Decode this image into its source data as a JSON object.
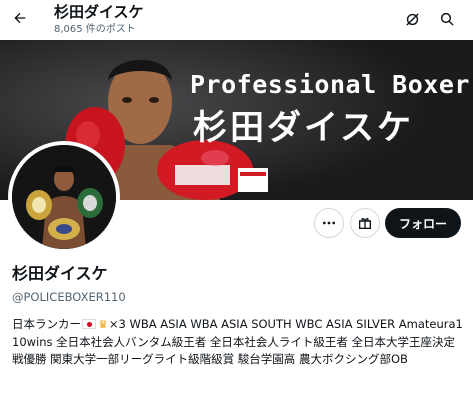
{
  "header": {
    "title": "杉田ダイスケ",
    "post_count": "8,065 件のポスト"
  },
  "banner": {
    "line1": "Professional Boxer",
    "line2": "杉田ダイスケ"
  },
  "actions": {
    "follow_label": "フォロー"
  },
  "profile": {
    "name": "杉田ダイスケ",
    "handle": "@POLICEBOXER110",
    "bio_prefix": "日本ランカー",
    "bio_main": "×3 WBA ASIA WBA ASIA SOUTH WBC ASIA SILVER Amateura110wins 全日本社会人バンタム級王者 全日本社会人ライト級王者 全日本大学王座決定戦優勝 関東大学一部リーグライト級階級賞 駿台学園高 農大ボクシング部OB"
  },
  "icons": {
    "back": "arrow-left-icon",
    "no_notify": "bell-off-icon",
    "search": "search-icon",
    "more": "more-icon",
    "gift": "gift-icon",
    "flag": "japan-flag-icon",
    "crown": "crown-icon"
  },
  "colors": {
    "follow_bg": "#0f1419",
    "muted": "#536471",
    "border": "#cfd9de"
  }
}
